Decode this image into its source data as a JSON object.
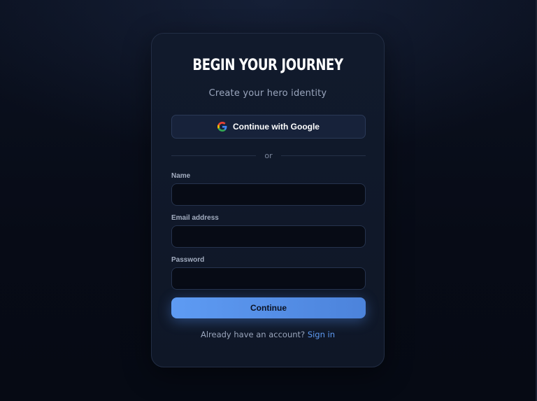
{
  "card": {
    "title": "BEGIN YOUR JOURNEY",
    "subtitle": "Create your hero identity"
  },
  "google_button": {
    "label": "Continue with Google",
    "icon": "google-icon"
  },
  "divider": {
    "text": "or"
  },
  "form": {
    "name": {
      "label": "Name",
      "value": ""
    },
    "email": {
      "label": "Email address",
      "value": ""
    },
    "password": {
      "label": "Password",
      "value": ""
    }
  },
  "continue_button": {
    "label": "Continue"
  },
  "footer": {
    "prompt": "Already have an account?",
    "link_label": "Sign in"
  },
  "colors": {
    "background": "#070b16",
    "card": "#111a2c",
    "accent": "#5e9bf3",
    "text": "#ffffff",
    "muted": "#9aa6bd"
  }
}
